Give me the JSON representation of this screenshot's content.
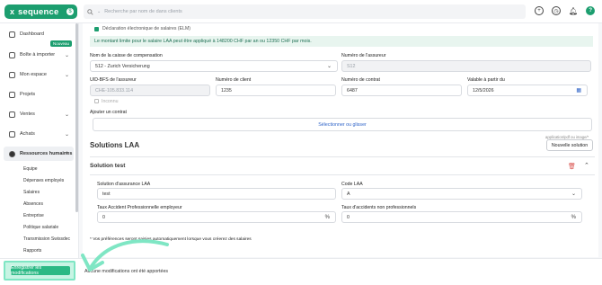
{
  "app": {
    "brand": "sequence",
    "brand_mark": "x",
    "brand_badge": "$"
  },
  "search": {
    "placeholder": "Recherche par nom de dans clients",
    "icon": "search-icon"
  },
  "top_icons": [
    "plus-icon",
    "clock-icon",
    "bell-icon"
  ],
  "help_label": "?",
  "sidebar": {
    "items": [
      {
        "label": "Dashboard"
      },
      {
        "label": "Boîte à importer",
        "badge": "Nouveau"
      },
      {
        "label": "Mon espace"
      },
      {
        "label": "Projets"
      },
      {
        "label": "Ventes"
      },
      {
        "label": "Achats"
      },
      {
        "label": "Ressources humaines"
      }
    ],
    "subitems": [
      "Equipe",
      "Dépenses employés",
      "Salaires",
      "Absences",
      "Entreprise",
      "Politique salariale",
      "Transmission Swissdec",
      "Rapports"
    ]
  },
  "form": {
    "checkbox_label": "Déclaration électronique de salaires (ELM)",
    "info": "Le montant limite pour le salaire LAA peut être appliqué à 148200 CHF par an ou 12350 CHF par mois.",
    "caisse_label": "Nom de la caisse de compensation",
    "caisse_value": "512 - Zurich Versicherung",
    "num_assureur_label": "Numéro de l'assureur",
    "num_assureur_value": "S12",
    "uid_label": "UID-BFS de l'assureur",
    "uid_value": "CHE-105.833.114",
    "client_label": "Numéro de client",
    "client_value": "1235",
    "contrat_label": "Numéro de contrat",
    "contrat_value": "6487",
    "valable_label": "Valable à partir du",
    "valable_value": "12/5/2026",
    "inconnu_label": "Inconnu",
    "contrat_upload_label": "Ajouter un contrat",
    "upload_text": "Sélectionner ou glisser",
    "solutions_title": "Solutions LAA",
    "upload_hint": "application/pdf ou image/*",
    "nouvelle_solution": "Nouvelle solution",
    "solution_name": "Solution test",
    "sol_assurance_label": "Solution d'assurance LAA",
    "sol_assurance_value": "test",
    "code_label": "Code LAA",
    "code_value": "A",
    "taux_pro_label": "Taux Accident Professionnelle employeur",
    "taux_pro_value": "0",
    "taux_non_pro_label": "Taux d'accidents non professionnels",
    "taux_non_pro_value": "0",
    "percent": "%",
    "note": "* Vos préférences seront saisies automatiquement lorsque vous créerez des salaires"
  },
  "footer": {
    "save_label": "Enregistrer les modifications",
    "message": "Aucune modifications ont été apportées"
  },
  "colors": {
    "brand": "#1c9e6f",
    "highlight": "#7fe6c4"
  }
}
